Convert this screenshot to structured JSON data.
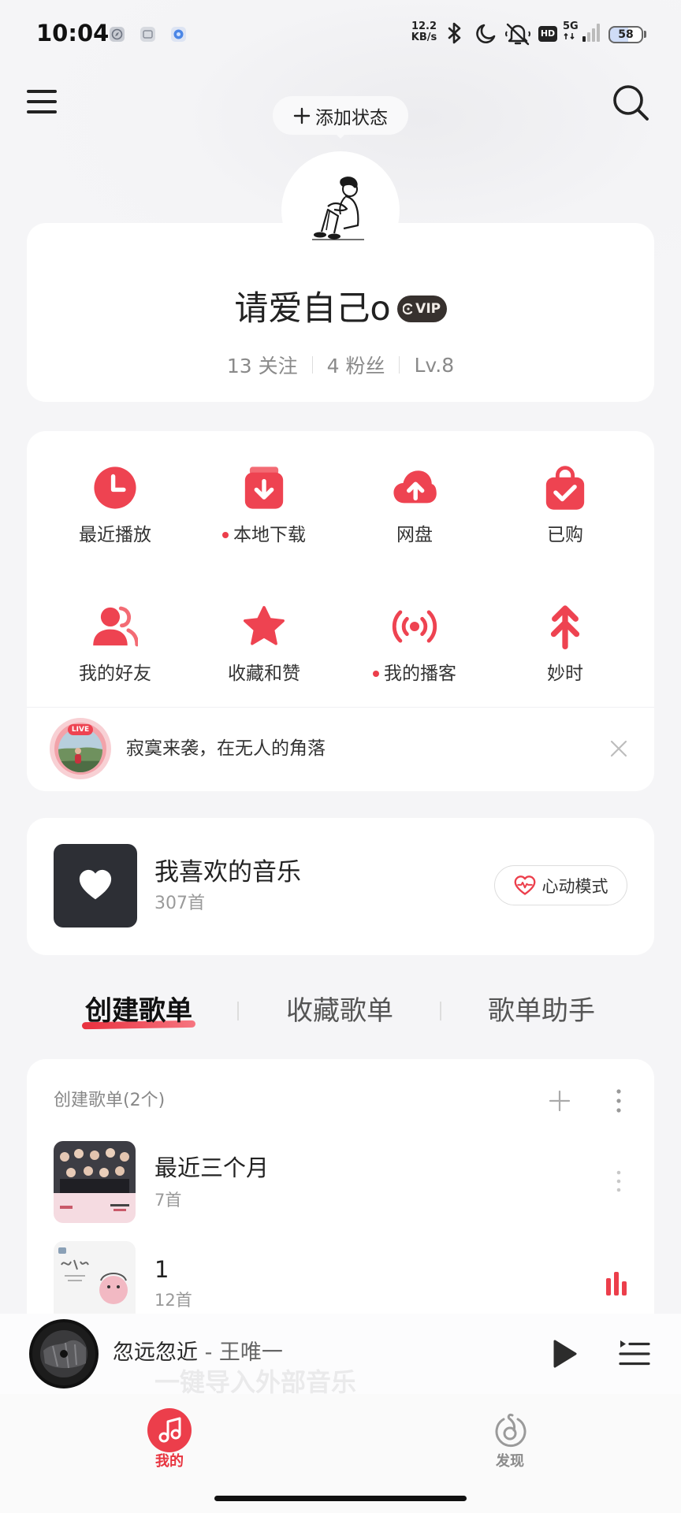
{
  "status_bar": {
    "time": "10:04",
    "app_icons": [
      "compass-app-icon",
      "gallery-app-icon",
      "blue-app-icon"
    ],
    "net_speed": "12.2",
    "net_speed_unit": "KB/s",
    "status_icons": [
      "bluetooth-icon",
      "moon-icon",
      "mute-icon"
    ],
    "hd_label": "HD",
    "network": "5G",
    "battery": "58",
    "battery_level": 0.58
  },
  "header": {
    "menu_icon": "menu-icon",
    "search_icon": "search-icon",
    "add_status": "添加状态"
  },
  "profile": {
    "name": "请爱自己o",
    "vip_badge": "VIP",
    "following": "13 关注",
    "followers": "4 粉丝",
    "level": "Lv.8"
  },
  "quick_actions": [
    {
      "label": "最近播放",
      "icon": "clock-icon",
      "dot": false
    },
    {
      "label": "本地下载",
      "icon": "download-icon",
      "dot": true
    },
    {
      "label": "网盘",
      "icon": "cloud-upload-icon",
      "dot": false
    },
    {
      "label": "已购",
      "icon": "shopping-bag-icon",
      "dot": false
    },
    {
      "label": "我的好友",
      "icon": "friends-icon",
      "dot": false
    },
    {
      "label": "收藏和赞",
      "icon": "star-icon",
      "dot": false
    },
    {
      "label": "我的播客",
      "icon": "podcast-icon",
      "dot": true
    },
    {
      "label": "妙时",
      "icon": "arrows-up-icon",
      "dot": false
    }
  ],
  "live_banner": {
    "badge": "LIVE",
    "text": "寂寞来袭，在无人的角落"
  },
  "liked_music": {
    "title": "我喜欢的音乐",
    "count": "307首",
    "mode_button": "心动模式"
  },
  "tabs": [
    {
      "label": "创建歌单",
      "active": true
    },
    {
      "label": "收藏歌单",
      "active": false
    },
    {
      "label": "歌单助手",
      "active": false
    }
  ],
  "playlists": {
    "header": "创建歌单(2个)",
    "items": [
      {
        "title": "最近三个月",
        "count": "7首",
        "playing": false
      },
      {
        "title": "1",
        "count": "12首",
        "playing": true
      }
    ]
  },
  "faded_row": "一键导入外部音乐",
  "mini_player": {
    "title": "忽远忽近",
    "artist": " - 王唯一"
  },
  "bottom_nav": [
    {
      "label": "我的",
      "icon": "music-note-icon",
      "active": true
    },
    {
      "label": "发现",
      "icon": "discover-icon",
      "active": false
    }
  ],
  "colors": {
    "accent": "#ec3e4b",
    "background": "#f5f5f7",
    "card": "#ffffff",
    "text_secondary": "#8a8a8a",
    "vip_badge": "#37312e"
  }
}
